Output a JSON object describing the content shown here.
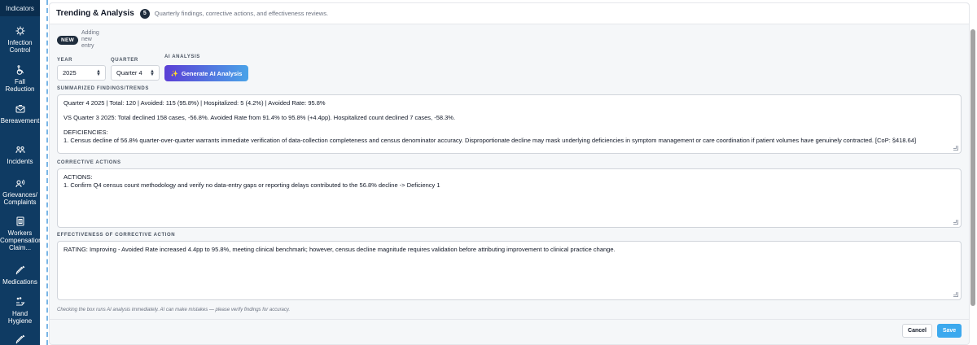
{
  "sidebar": {
    "top_label": "Indicators",
    "items": [
      {
        "label": "Infection Control",
        "icon": "virus-icon"
      },
      {
        "label": "Fall Reduction",
        "icon": "wheelchair-icon"
      },
      {
        "label": "Bereavement",
        "icon": "envelope-icon"
      },
      {
        "label": "Incidents",
        "icon": "people-icon"
      },
      {
        "label": "Grievances/ Complaints",
        "icon": "speaker-icon"
      },
      {
        "label": "Workers Compensation Claim...",
        "icon": "clipboard-icon"
      },
      {
        "label": "Medications",
        "icon": "syringe-icon"
      },
      {
        "label": "Hand Hygiene",
        "icon": "hand-wash-icon"
      }
    ]
  },
  "header": {
    "title": "Trending & Analysis",
    "count": "5",
    "subtitle": "Quarterly findings, corrective actions, and effectiveness reviews."
  },
  "entry": {
    "new_badge": "NEW",
    "new_text": "Adding new entry"
  },
  "form": {
    "year_label": "YEAR",
    "year_value": "2025",
    "quarter_label": "QUARTER",
    "quarter_value": "Quarter 4",
    "ai_label": "AI ANALYSIS",
    "ai_button": "Generate AI Analysis",
    "findings_label": "SUMMARIZED FINDINGS/TRENDS",
    "findings_lines": [
      "Quarter 4 2025 | Total: 120 | Avoided: 115 (95.8%) | Hospitalized: 5 (4.2%) | Avoided Rate: 95.8%",
      "VS Quarter 3 2025: Total declined 158 cases, -56.8%. Avoided Rate from 91.4% to 95.8% (+4.4pp). Hospitalized count declined 7 cases, -58.3%.",
      "DEFICIENCIES:",
      "1. Census decline of 56.8% quarter-over-quarter warrants immediate verification of data-collection completeness and census denominator accuracy. Disproportionate decline may mask underlying deficiencies in symptom management or care coordination if patient volumes have genuinely contracted. [CoP: §418.64]"
    ],
    "corrective_label": "CORRECTIVE ACTIONS",
    "corrective_lines": [
      "ACTIONS:",
      "1. Confirm Q4 census count methodology and verify no data-entry gaps or reporting delays contributed to the 56.8% decline -> Deficiency 1"
    ],
    "effectiveness_label": "EFFECTIVENESS OF CORRECTIVE ACTION",
    "effectiveness_lines": [
      "RATING: Improving - Avoided Rate increased 4.4pp to 95.8%, meeting clinical benchmark; however, census decline magnitude requires validation before attributing improvement to clinical practice change."
    ],
    "disclaimer": "Checking the box runs AI analysis immediately. AI can make mistakes — please verify findings for accuracy."
  },
  "footer": {
    "cancel": "Cancel",
    "save": "Save"
  },
  "colors": {
    "sidebar": "#0f3b63",
    "accent": "#3ca9ee",
    "ai_gradient_start": "#5b3fd6",
    "ai_gradient_end": "#4aa3e8"
  }
}
